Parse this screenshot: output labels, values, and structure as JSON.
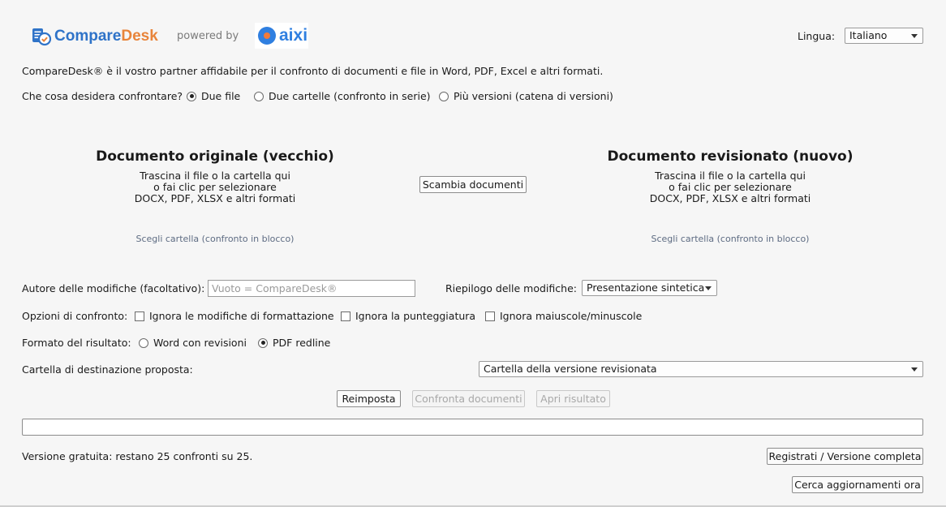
{
  "header": {
    "brand_part1": "Compare",
    "brand_part2": "Desk",
    "powered_by": "powered by",
    "partner_logo_text": "aixi",
    "language_label": "Lingua:",
    "language_value": "Italiano"
  },
  "intro_text": "CompareDesk® è il vostro partner affidabile per il confronto di documenti e file in Word, PDF, Excel e altri formati.",
  "compare_mode": {
    "label": "Che cosa desidera confrontare?",
    "options": [
      {
        "label": "Due file",
        "selected": true
      },
      {
        "label": "Due cartelle (confronto in serie)",
        "selected": false
      },
      {
        "label": "Più versioni (catena di versioni)",
        "selected": false
      }
    ]
  },
  "original_doc": {
    "title": "Documento originale (vecchio)",
    "hint_line1": "Trascina il file o la cartella qui",
    "hint_line2": "o fai clic per selezionare",
    "hint_line3": "DOCX, PDF, XLSX e altri formati",
    "folder_link": "Scegli cartella (confronto in blocco)"
  },
  "revised_doc": {
    "title": "Documento revisionato (nuovo)",
    "hint_line1": "Trascina il file o la cartella qui",
    "hint_line2": "o fai clic per selezionare",
    "hint_line3": "DOCX, PDF, XLSX e altri formati",
    "folder_link": "Scegli cartella (confronto in blocco)"
  },
  "swap_button": "Scambia documenti",
  "author": {
    "label": "Autore delle modifiche (facoltativo):",
    "placeholder": "Vuoto = CompareDesk®",
    "value": ""
  },
  "summary": {
    "label": "Riepilogo delle modifiche:",
    "value": "Presentazione sintetica"
  },
  "options": {
    "label": "Opzioni di confronto:",
    "items": [
      {
        "label": "Ignora le modifiche di formattazione",
        "checked": false
      },
      {
        "label": "Ignora la punteggiatura",
        "checked": false
      },
      {
        "label": "Ignora maiuscole/minuscole",
        "checked": false
      }
    ]
  },
  "result_format": {
    "label": "Formato del risultato:",
    "options": [
      {
        "label": "Word con revisioni",
        "selected": false
      },
      {
        "label": "PDF redline",
        "selected": true
      }
    ]
  },
  "destination": {
    "label": "Cartella di destinazione proposta:",
    "value": "Cartella della versione revisionata"
  },
  "actions": {
    "reset": "Reimposta",
    "compare": "Confronta documenti",
    "open_result": "Apri risultato"
  },
  "progress": 0,
  "footer": {
    "status": "Versione gratuita: restano 25 confronti su 25.",
    "register_button": "Registrati / Versione completa",
    "update_button": "Cerca aggiornamenti ora"
  }
}
